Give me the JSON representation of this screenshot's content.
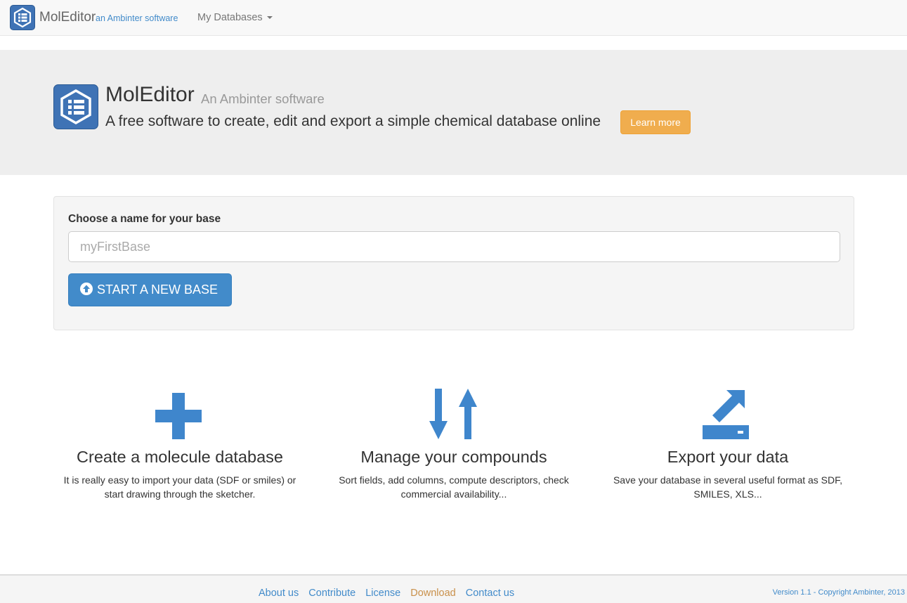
{
  "navbar": {
    "brand_name": "MolEditor",
    "brand_sub": "an Ambinter software",
    "dropdown_label": "My Databases"
  },
  "hero": {
    "title": "MolEditor",
    "subtitle": "An Ambinter software",
    "tagline": "A free software to create, edit and export a simple chemical database online",
    "learn_more": "Learn more"
  },
  "form": {
    "label": "Choose a name for your base",
    "input_value": "",
    "input_placeholder": "myFirstBase",
    "start_button": "START A NEW BASE"
  },
  "features": [
    {
      "icon": "plus-icon",
      "title": "Create a molecule database",
      "text": "It is really easy to import your data (SDF or smiles) or start drawing through the sketcher."
    },
    {
      "icon": "sort-arrows-icon",
      "title": "Manage your compounds",
      "text": "Sort fields, add columns, compute descriptors, check commercial availability..."
    },
    {
      "icon": "export-icon",
      "title": "Export your data",
      "text": "Save your database in several useful format as SDF, SMILES, XLS..."
    }
  ],
  "footer": {
    "links": [
      "About us",
      "Contribute",
      "License",
      "Download",
      "Contact us"
    ],
    "copyright": "Version 1.1 - Copyright Ambinter, 2013"
  },
  "colors": {
    "primary": "#428bca",
    "warning": "#f0ad4e",
    "brand_logo": "#3f73b5",
    "icon_blue": "#3f86cc"
  }
}
